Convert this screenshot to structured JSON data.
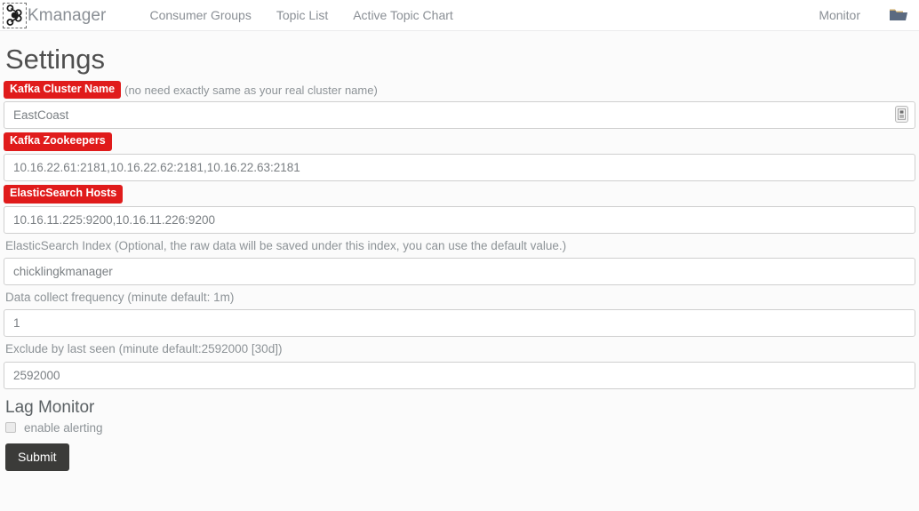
{
  "navbar": {
    "logo_icon": "kafka-node-graph-icon",
    "brand": "Kmanager",
    "links": [
      {
        "label": "Consumer Groups"
      },
      {
        "label": "Topic List"
      },
      {
        "label": "Active Topic Chart"
      }
    ],
    "right": {
      "monitor_label": "Monitor",
      "folder_icon": "folder-icon"
    }
  },
  "page": {
    "title": "Settings",
    "fields": [
      {
        "label": "Kafka Cluster Name",
        "label_style": "badge",
        "hint": "(no need exactly same as your real cluster name)",
        "value": "EastCoast",
        "has_autofill_icon": true,
        "autofill_icon": "id-card-autofill-icon"
      },
      {
        "label": "Kafka Zookeepers",
        "label_style": "badge",
        "hint": "",
        "value": "10.16.22.61:2181,10.16.22.62:2181,10.16.22.63:2181",
        "has_autofill_icon": false
      },
      {
        "label": "ElasticSearch Hosts",
        "label_style": "badge",
        "hint": "",
        "value": "10.16.11.225:9200,10.16.11.226:9200",
        "has_autofill_icon": false
      },
      {
        "label": "ElasticSearch Index (Optional, the raw data will be saved under this index, you can use the default value.)",
        "label_style": "plain",
        "hint": "",
        "value": "chicklingkmanager",
        "has_autofill_icon": false
      },
      {
        "label": "Data collect frequency (minute default: 1m)",
        "label_style": "plain",
        "hint": "",
        "value": "1",
        "has_autofill_icon": false
      },
      {
        "label": "Exclude by last seen (minute default:2592000 [30d])",
        "label_style": "plain",
        "hint": "",
        "value": "2592000",
        "has_autofill_icon": false
      }
    ],
    "lag_monitor": {
      "section_title": "Lag Monitor",
      "checkbox_label": "enable alerting",
      "checkbox_checked": false
    },
    "submit_label": "Submit"
  },
  "colors": {
    "badge_red": "#e01b1b",
    "submit_dark": "#3b3b39",
    "nav_text": "#8a8f95",
    "page_bg": "#fbfbfb",
    "input_border": "#cfcfcf"
  }
}
